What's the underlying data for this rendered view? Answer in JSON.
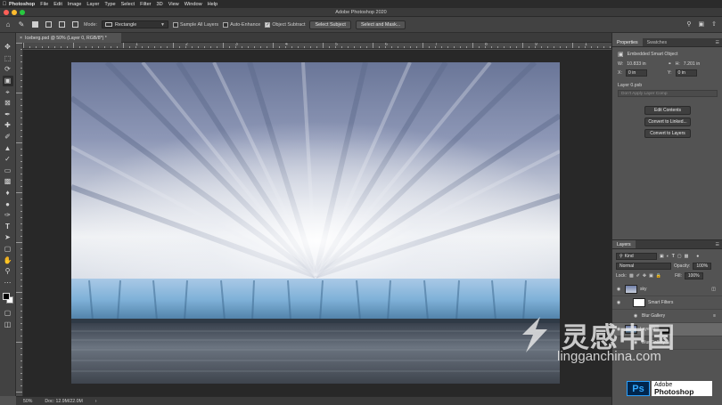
{
  "menubar": {
    "apple_icon": "apple-icon",
    "app_name": "Photoshop",
    "items": [
      "File",
      "Edit",
      "Image",
      "Layer",
      "Type",
      "Select",
      "Filter",
      "3D",
      "View",
      "Window",
      "Help"
    ]
  },
  "window": {
    "title": "Adobe Photoshop 2020"
  },
  "options_bar": {
    "mode_label": "Mode:",
    "mode_value": "Rectangle",
    "sample_all_layers": "Sample All Layers",
    "auto_enhance": "Auto-Enhance",
    "object_subtract": "Object Subtract",
    "select_subject": "Select Subject",
    "select_and_mask": "Select and Mask..."
  },
  "document": {
    "tab_title": "Iceberg.psd @ 50% (Layer 0, RGB/8*) *",
    "close_glyph": "×",
    "zoom": "50%",
    "doc_info": "Doc: 12.9M/22.0M",
    "status_caret": "›"
  },
  "ruler": {
    "marks": [
      "1",
      "2",
      "3",
      "4",
      "5",
      "6",
      "7",
      "8",
      "9",
      "1"
    ]
  },
  "properties": {
    "tab_properties": "Properties",
    "tab_swatches": "Swatches",
    "type_label": "Embedded Smart Object",
    "w_label": "W:",
    "w_value": "10.833 in",
    "h_label": "H:",
    "h_value": "7.201 in",
    "x_label": "X:",
    "x_value": "0 in",
    "y_label": "Y:",
    "y_value": "0 in",
    "source_file": "Layer 0.psb",
    "layer_comp_placeholder": "Don't Apply Layer Comp",
    "btn_edit_contents": "Edit Contents",
    "btn_convert_linked": "Convert to Linked...",
    "btn_convert_layers": "Convert to Layers"
  },
  "layers": {
    "tab_label": "Layers",
    "filter_kind": "Kind",
    "blend_mode": "Normal",
    "opacity_label": "Opacity:",
    "opacity_value": "100%",
    "lock_label": "Lock:",
    "fill_label": "Fill:",
    "fill_value": "100%",
    "items": [
      {
        "name": "sky"
      },
      {
        "name": "Smart Filters"
      },
      {
        "name": "Blur Gallery"
      },
      {
        "name": "Layer 0"
      },
      {
        "name": "Blur Gallery"
      }
    ]
  },
  "watermark": {
    "cn_text": "灵感中国",
    "url_text": "lingganchina.com",
    "ps_badge": "Ps",
    "adobe_line1": "Adobe",
    "adobe_line2": "Photoshop"
  },
  "colors": {
    "ui_dark": "#2b2b2b",
    "panel": "#535353",
    "accent_blue": "#31a8ff",
    "close_red": "#fe5f57",
    "minimize_yellow": "#febc2e",
    "zoom_green": "#28c840"
  }
}
